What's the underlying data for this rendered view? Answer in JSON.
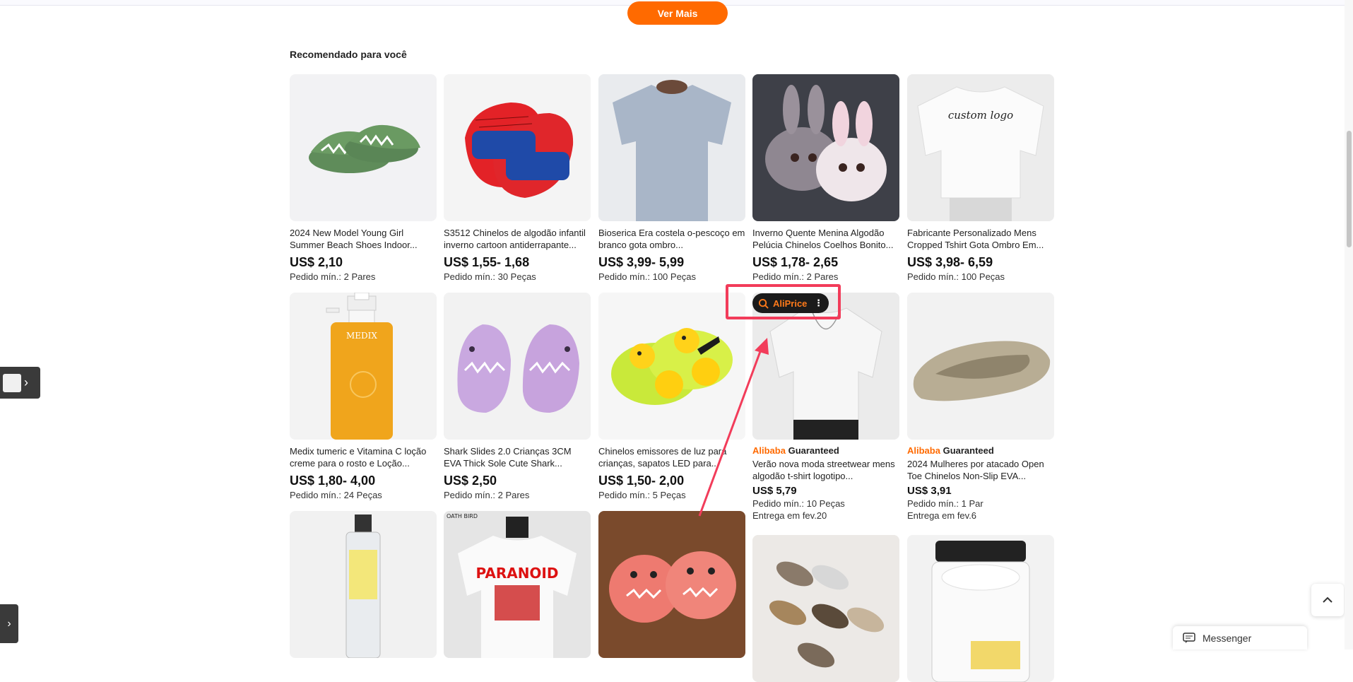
{
  "ver_mais": "Ver Mais",
  "section_title": "Recomendado para você",
  "products": [
    {
      "title": "2024 New Model Young Girl Summer Beach Shoes Indoor...",
      "price": "US$ 2,10",
      "moq": "Pedido mín.: 2 Pares"
    },
    {
      "title": "S3512 Chinelos de algodão infantil inverno cartoon antiderrapante...",
      "price": "US$ 1,55- 1,68",
      "moq": "Pedido mín.: 30 Peças"
    },
    {
      "title": "Bioserica Era costela o-pescoço em branco gota ombro...",
      "price": "US$ 3,99- 5,99",
      "moq": "Pedido mín.: 100 Peças"
    },
    {
      "title": "Inverno Quente Menina Algodão Pelúcia Chinelos Coelhos Bonito...",
      "price": "US$ 1,78- 2,65",
      "moq": "Pedido mín.: 2 Pares"
    },
    {
      "title": "Fabricante Personalizado Mens Cropped Tshirt Gota Ombro Em...",
      "price": "US$ 3,98- 6,59",
      "moq": "Pedido mín.: 100 Peças",
      "image_text": "custom logo"
    },
    {
      "title": "Medix tumeric e Vitamina C loção creme para o rosto e Loção...",
      "price": "US$ 1,80- 4,00",
      "moq": "Pedido mín.: 24 Peças",
      "image_text": "MEDIX"
    },
    {
      "title": "Shark Slides 2.0 Crianças 3CM EVA Thick Sole Cute Shark...",
      "price": "US$ 2,50",
      "moq": "Pedido mín.: 2 Pares"
    },
    {
      "title": "Chinelos emissores de luz para crianças, sapatos LED para...",
      "price": "US$ 1,50- 2,00",
      "moq": "Pedido mín.: 5 Peças"
    },
    {
      "title": "Verão nova moda streetwear mens algodão t-shirt logotipo...",
      "price": "US$ 5,79",
      "moq": "Pedido mín.: 10 Peças",
      "delivery": "Entrega em fev.20",
      "badge_ali": "Alibaba",
      "badge_g": "Guaranteed"
    },
    {
      "title": "2024 Mulheres por atacado Open Toe Chinelos Non-Slip EVA...",
      "price": "US$ 3,91",
      "moq": "Pedido mín.: 1 Par",
      "delivery": "Entrega em fev.6",
      "badge_ali": "Alibaba",
      "badge_g": "Guaranteed"
    },
    {
      "image_text": "OATH BIRD"
    },
    {
      "image_text": "PARANOID"
    }
  ],
  "aliprice_label": "AliPrice",
  "messenger_label": "Messenger",
  "colors": {
    "accent": "#ff6a00",
    "highlight": "#f23c5a"
  }
}
